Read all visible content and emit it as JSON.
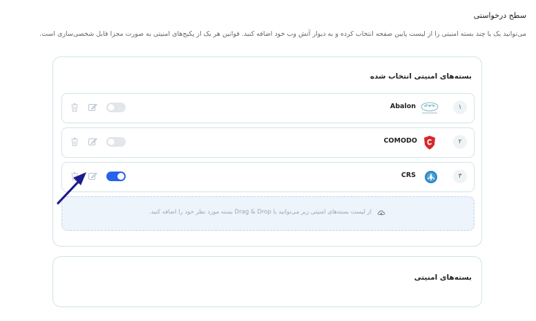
{
  "header": {
    "title": "سطح درخواستی",
    "description": "می‌توانید یک یا چند بسته امنیتی را از لیست پایین صفحه انتخاب کرده و به دیوار آتش وب خود اضافه کنید. قوانین هر یک از پکیج‌های امنیتی به صورت مجزا قابل شخصی‌سازی است."
  },
  "selected_packages": {
    "title": "بسته‌های امنیتی انتخاب شده",
    "items": [
      {
        "index": "۱",
        "name": "Abalon",
        "logo": "abalon-logo",
        "enabled": false
      },
      {
        "index": "۲",
        "name": "COMODO",
        "logo": "comodo-shield-logo",
        "enabled": false
      },
      {
        "index": "۳",
        "name": "CRS",
        "logo": "crs-logo",
        "enabled": true
      }
    ],
    "dropzone_text": "از لیست بسته‌های امنیتی زیر می‌توانید با Drag & Drop بسته مورد نظر خود را اضافه کنید."
  },
  "package_library": {
    "title": "بسته‌های امنیتی"
  },
  "colors": {
    "accent": "#2563eb",
    "comodo_red": "#d9262b",
    "crs_blue": "#2b86c4",
    "annotation_arrow": "#1e1b8f"
  }
}
